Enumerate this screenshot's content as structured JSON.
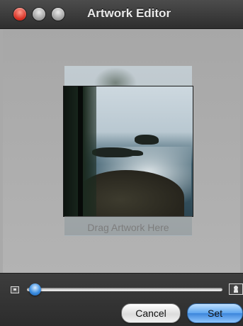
{
  "window": {
    "title": "Artwork Editor",
    "controls": [
      "close-button",
      "minimize-button",
      "zoom-button"
    ]
  },
  "artwork": {
    "drop_label": "Drag Artwork Here"
  },
  "zoom": {
    "level": 0.04,
    "min_icon": "small-image-icon",
    "max_icon": "large-image-icon"
  },
  "buttons": {
    "cancel_label": "Cancel",
    "set_label": "Set"
  },
  "colors": {
    "close": "#d4281b",
    "accent": "#3c86db"
  }
}
